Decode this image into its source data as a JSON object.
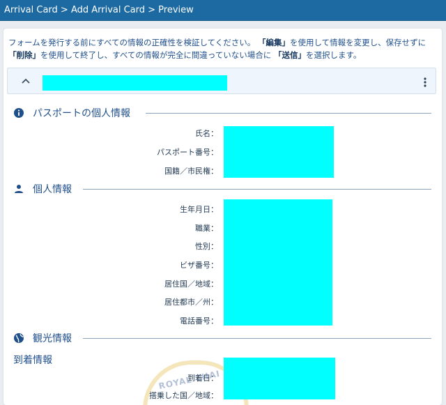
{
  "breadcrumb": "Arrival Card > Add Arrival Card > Preview",
  "instructions": {
    "part1": "フォームを発行する前にすべての情報の正確性を検証してください。",
    "edit": "「編集」",
    "part2": "を使用して情報を変更し、保存せずに",
    "delete": "「削除」",
    "part3": "を使用して終了し、すべての情報が完全に間違っていない場合に",
    "submit": "「送信」",
    "part4": "を選択します。"
  },
  "sections": {
    "passport": {
      "title": "パスポートの個人情報",
      "icon": "info-icon",
      "fields": [
        "氏名：",
        "パスポート番号：",
        "国籍／市民権："
      ]
    },
    "personal": {
      "title": "個人情報",
      "icon": "person-icon",
      "fields": [
        "生年月日：",
        "職業：",
        "性別：",
        "ビザ番号：",
        "居住国／地域：",
        "居住都市／州：",
        "電話番号："
      ]
    },
    "travel": {
      "title": "観光情報",
      "icon": "globe-icon",
      "subheading": "到着情報",
      "fields": [
        "到着日：",
        "搭乗した国／地域："
      ]
    }
  },
  "seal_text": "ROYAL THAI",
  "colors": {
    "topbar": "#1d6aa3",
    "accent_text": "#1f4f8a",
    "redaction": "#00ffff"
  }
}
